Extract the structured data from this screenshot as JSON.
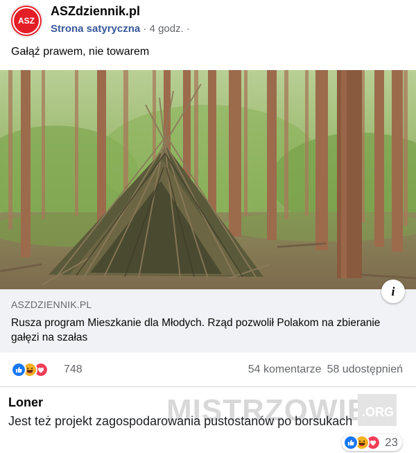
{
  "post": {
    "page_name": "ASZdziennik.pl",
    "avatar_text": "ASZ",
    "subtitle": "Strona satyryczna",
    "time": "4 godz.",
    "separator": "·",
    "privacy_dot": "·",
    "text": "Gałąź prawem, nie towarem"
  },
  "link": {
    "domain": "ASZDZIENNIK.PL",
    "title": "Rusza program Mieszkanie dla Młodych. Rząd pozwolił Polakom na zbieranie gałęzi na szałas",
    "info_icon": "i"
  },
  "reactions": {
    "icons": [
      "like-icon",
      "haha-icon",
      "love-icon"
    ],
    "count": "748",
    "comments": "54 komentarze",
    "shares": "58 udostępnień"
  },
  "comment": {
    "author": "Loner",
    "text": "Jest też projekt zagospodarowania pustostanów po borsukach",
    "reaction_count": "23"
  },
  "watermark": {
    "text": "MISTRZOWIE",
    "suffix": ".ORG"
  },
  "colors": {
    "like": "#1877f2",
    "haha": "#f7b125",
    "love": "#f33e58",
    "avatar_red": "#e41e26",
    "link_blue": "#385898"
  }
}
